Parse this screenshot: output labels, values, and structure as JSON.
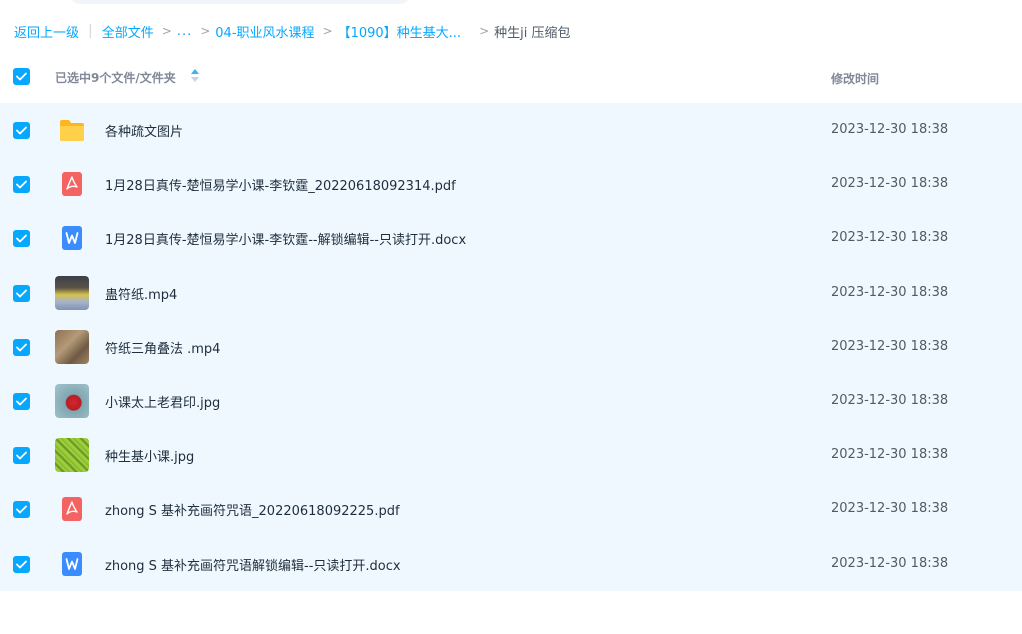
{
  "breadcrumb": {
    "back": "返回上一级",
    "all_files": "全部文件",
    "ellipsis": "...",
    "crumb1": "04-职业风水课程",
    "crumb2": "【1090】种生基大...",
    "current": "种生ji 压缩包"
  },
  "header": {
    "title": "已选中9个文件/文件夹",
    "time_label": "修改时间"
  },
  "colors": {
    "accent": "#06a7ff",
    "selected_row_bg": "#eef8fe",
    "folder": "#ffc53d",
    "pdf": "#f56262",
    "doc": "#3b8cff"
  },
  "files": [
    {
      "name": "各种疏文图片",
      "time": "2023-12-30 18:38",
      "icon": "folder-icon"
    },
    {
      "name": "1月28日真传-楚恒易学小课-李钦霆_20220618092314.pdf",
      "time": "2023-12-30 18:38",
      "icon": "pdf-icon"
    },
    {
      "name": "1月28日真传-楚恒易学小课-李钦霆--解锁编辑--只读打开.docx",
      "time": "2023-12-30 18:38",
      "icon": "doc-icon"
    },
    {
      "name": "蛊符纸.mp4",
      "time": "2023-12-30 18:38",
      "icon": "video-thumbnail"
    },
    {
      "name": "符纸三角叠法 .mp4",
      "time": "2023-12-30 18:38",
      "icon": "video-thumbnail"
    },
    {
      "name": "小课太上老君印.jpg",
      "time": "2023-12-30 18:38",
      "icon": "image-thumbnail"
    },
    {
      "name": "种生基小课.jpg",
      "time": "2023-12-30 18:38",
      "icon": "image-thumbnail"
    },
    {
      "name": "zhong S 基补充画符咒语_20220618092225.pdf",
      "time": "2023-12-30 18:38",
      "icon": "pdf-icon"
    },
    {
      "name": "zhong S 基补充画符咒语解锁编辑--只读打开.docx",
      "time": "2023-12-30 18:38",
      "icon": "doc-icon"
    }
  ]
}
